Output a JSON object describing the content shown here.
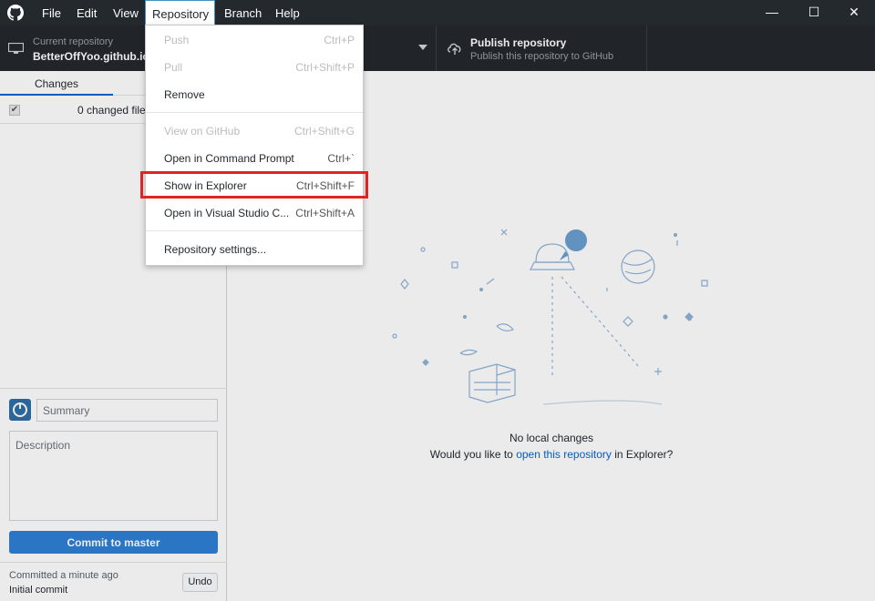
{
  "window": {
    "menu": [
      "File",
      "Edit",
      "View",
      "Repository",
      "Branch",
      "Help"
    ],
    "open_menu": "Repository",
    "controls": {
      "minimize": "—",
      "maximize": "☐",
      "close": "✕"
    }
  },
  "toolbar": {
    "current_repo_label": "Current repository",
    "current_repo_value": "BetterOffYoo.github.io",
    "publish_title": "Publish repository",
    "publish_sub": "Publish this repository to GitHub"
  },
  "repository_menu": {
    "items": [
      {
        "label": "Push",
        "shortcut": "Ctrl+P",
        "enabled": false
      },
      {
        "label": "Pull",
        "shortcut": "Ctrl+Shift+P",
        "enabled": false
      },
      {
        "label": "Remove",
        "shortcut": "",
        "enabled": true
      },
      {
        "label": "View on GitHub",
        "shortcut": "Ctrl+Shift+G",
        "enabled": false
      },
      {
        "label": "Open in Command Prompt",
        "shortcut": "Ctrl+`",
        "enabled": true
      },
      {
        "label": "Show in Explorer",
        "shortcut": "Ctrl+Shift+F",
        "enabled": true,
        "highlighted": true
      },
      {
        "label": "Open in Visual Studio C...",
        "shortcut": "Ctrl+Shift+A",
        "enabled": true
      },
      {
        "label": "Repository settings...",
        "shortcut": "",
        "enabled": true
      }
    ]
  },
  "sidebar": {
    "tab_changes": "Changes",
    "changed_files": "0 changed files",
    "summary_placeholder": "Summary",
    "description_placeholder": "Description",
    "commit_button": "Commit to master",
    "last_commit_time": "Committed a minute ago",
    "last_commit_message": "Initial commit",
    "undo": "Undo"
  },
  "blank_slate": {
    "title": "No local changes",
    "question_pre": "Would you like to ",
    "question_link": "open this repository",
    "question_post": " in Explorer?"
  },
  "colors": {
    "titlebar": "#24292e",
    "accent": "#0366d6",
    "commit_button": "#2f7fd6",
    "highlight": "#e02424"
  }
}
